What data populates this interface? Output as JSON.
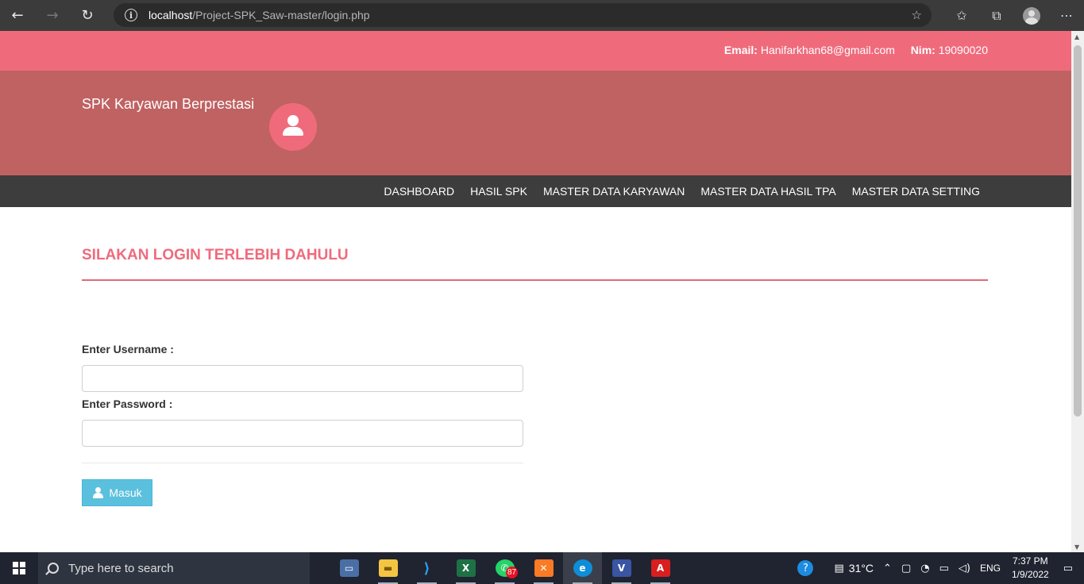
{
  "browser": {
    "url_host": "localhost",
    "url_path": "/Project-SPK_Saw-master/login.php"
  },
  "topbar": {
    "email_label": "Email:",
    "email_value": "Hanifarkhan68@gmail.com",
    "nim_label": "Nim:",
    "nim_value": "19090020"
  },
  "header": {
    "title": "SPK Karyawan Berprestasi",
    "logo_icon": "user-icon"
  },
  "nav": {
    "items": [
      {
        "label": "DASHBOARD"
      },
      {
        "label": "HASIL SPK"
      },
      {
        "label": "MASTER DATA KARYAWAN"
      },
      {
        "label": "MASTER DATA HASIL TPA"
      },
      {
        "label": "MASTER DATA SETTING"
      }
    ]
  },
  "login": {
    "heading": "SILAKAN LOGIN TERLEBIH DAHULU",
    "username_label": "Enter Username :",
    "username_value": "",
    "password_label": "Enter Password :",
    "password_value": "",
    "submit_label": "Masuk"
  },
  "taskbar": {
    "search_placeholder": "Type here to search",
    "whatsapp_badge": "87",
    "weather": "31°C",
    "language": "ENG",
    "time": "7:37 PM",
    "date": "1/9/2022"
  },
  "colors": {
    "topbar": "#ef6b7c",
    "header": "#c06262",
    "navbar": "#3d3d3d",
    "accent": "#ef6b7c",
    "button": "#5bc0de"
  }
}
